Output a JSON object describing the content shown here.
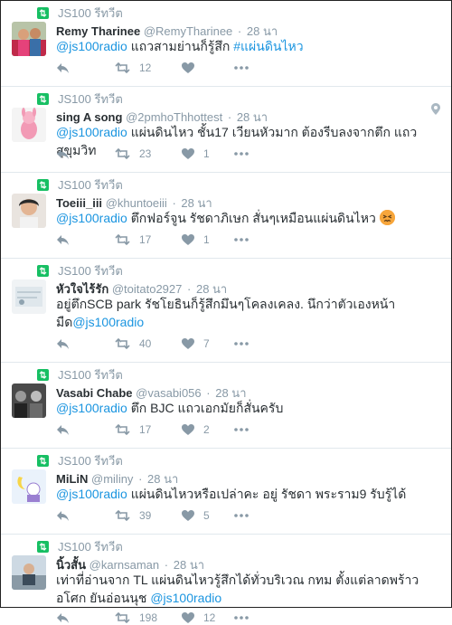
{
  "retweet_label": "JS100 รีทวีต",
  "tweets": [
    {
      "name": "Remy Tharinee",
      "handle": "@RemyTharinee",
      "time": "28 นา",
      "text_pre": "",
      "mention": "@js100radio",
      "text": " แถวสามย่านก็รู้สึก ",
      "hashtag": "#แผ่นดินไหว",
      "text2": "",
      "retweets": "12",
      "likes": "",
      "has_location": false
    },
    {
      "name": "sing A song",
      "handle": "@2pmhoThhottest",
      "time": "28 นา",
      "text_pre": "",
      "mention": "@js100radio",
      "text": " แผ่นดินไหว ชั้น17 เวียนหัวมาก ต้องรีบลงจากตึก แถวสุขุมวิท",
      "hashtag": "",
      "text2": "",
      "retweets": "23",
      "likes": "1",
      "has_location": true
    },
    {
      "name": "Toeiii_iii",
      "handle": "@khuntoeiii",
      "time": "28 นา",
      "text_pre": "",
      "mention": "@js100radio",
      "text": " ตึกฟอร์จูน รัชดาภิเษก สั่นๆเหมือนแผ่นดินไหว ",
      "hashtag": "",
      "text2": "",
      "retweets": "17",
      "likes": "1",
      "has_location": false
    },
    {
      "name": "หัวใจไร้รัก",
      "handle": "@toitato2927",
      "time": "28 นา",
      "text_pre": "อยู่ตึกSCB park รัชโยธินก็รู้สึกมึนๆโคลงเคลง. นึกว่าตัวเองหน้ามืด",
      "mention": "@js100radio",
      "text": "",
      "hashtag": "",
      "text2": "",
      "retweets": "40",
      "likes": "7",
      "has_location": false
    },
    {
      "name": "Vasabi Chabe",
      "handle": "@vasabi056",
      "time": "28 นา",
      "text_pre": "",
      "mention": "@js100radio",
      "text": " ตึก BJC แถวเอกมัยก็สั่นครับ",
      "hashtag": "",
      "text2": "",
      "retweets": "17",
      "likes": "2",
      "has_location": false
    },
    {
      "name": "MiLiN",
      "handle": "@miliny",
      "time": "28 นา",
      "text_pre": "",
      "mention": "@js100radio",
      "text": " แผ่นดินไหวหรือเปล่าคะ อยู่ รัชดา พระราม9 รับรู้ได้",
      "hashtag": "",
      "text2": "",
      "retweets": "39",
      "likes": "5",
      "has_location": false
    },
    {
      "name": "นิ้วสั้น",
      "handle": "@karnsaman",
      "time": "28 นา",
      "text_pre": "เท่าที่อ่านจาก TL แผ่นดินไหวรู้สึกได้ทั่วบริเวณ กทม ตั้งแต่ลาดพร้าว อโศก ยันอ่อนนุช ",
      "mention": "@js100radio",
      "text": "",
      "hashtag": "",
      "text2": "",
      "retweets": "198",
      "likes": "12",
      "has_location": false
    }
  ],
  "colors": {
    "link": "#1b95e0",
    "muted": "#8899a6",
    "retweet_green": "#17bf63",
    "text": "#292f33"
  }
}
